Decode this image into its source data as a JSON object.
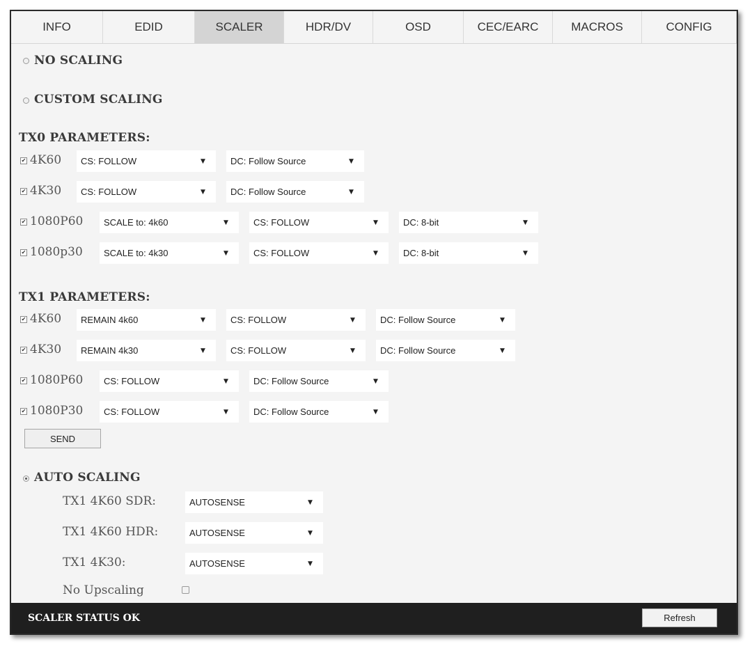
{
  "tabs": [
    "INFO",
    "EDID",
    "SCALER",
    "HDR/DV",
    "OSD",
    "CEC/EARC",
    "MACROS",
    "CONFIG"
  ],
  "active_tab": "SCALER",
  "modes": {
    "no_scaling": "NO SCALING",
    "custom_scaling": "CUSTOM SCALING",
    "auto_scaling": "AUTO SCALING",
    "selected": "AUTO SCALING"
  },
  "tx0": {
    "heading": "TX0 PARAMETERS:",
    "rows": [
      {
        "label": "4K60",
        "checked": true,
        "selects": [
          "CS: FOLLOW",
          "DC: Follow Source"
        ]
      },
      {
        "label": "4K30",
        "checked": true,
        "selects": [
          "CS: FOLLOW",
          "DC: Follow Source"
        ]
      },
      {
        "label": "1080P60",
        "checked": true,
        "selects": [
          "SCALE to: 4k60",
          "CS: FOLLOW",
          "DC: 8-bit"
        ]
      },
      {
        "label": "1080p30",
        "checked": true,
        "selects": [
          "SCALE to: 4k30",
          "CS: FOLLOW",
          "DC: 8-bit"
        ]
      }
    ]
  },
  "tx1": {
    "heading": "TX1 PARAMETERS:",
    "rows": [
      {
        "label": "4K60",
        "checked": true,
        "selects": [
          "REMAIN 4k60",
          "CS: FOLLOW",
          "DC: Follow Source"
        ]
      },
      {
        "label": "4K30",
        "checked": true,
        "selects": [
          "REMAIN 4k30",
          "CS: FOLLOW",
          "DC: Follow Source"
        ]
      },
      {
        "label": "1080P60",
        "checked": true,
        "selects": [
          "CS: FOLLOW",
          "DC: Follow Source"
        ]
      },
      {
        "label": "1080P30",
        "checked": true,
        "selects": [
          "CS: FOLLOW",
          "DC: Follow Source"
        ]
      }
    ]
  },
  "send_label": "SEND",
  "auto": {
    "rows": [
      {
        "label": "TX1 4K60 SDR:",
        "value": "AUTOSENSE"
      },
      {
        "label": "TX1 4K60 HDR:",
        "value": "AUTOSENSE"
      },
      {
        "label": "TX1 4K30:",
        "value": "AUTOSENSE"
      }
    ],
    "no_upscaling_label": "No Upscaling",
    "no_upscaling_checked": false
  },
  "footer": {
    "status": "SCALER STATUS OK",
    "refresh_label": "Refresh"
  },
  "icons": {
    "dropdown": "dropdown-arrow-icon",
    "check": "checkmark-icon"
  },
  "colors": {
    "footer_bg": "#1f1f1f",
    "active_tab_bg": "#d4d4d4",
    "panel_bg": "#f4f4f4"
  }
}
